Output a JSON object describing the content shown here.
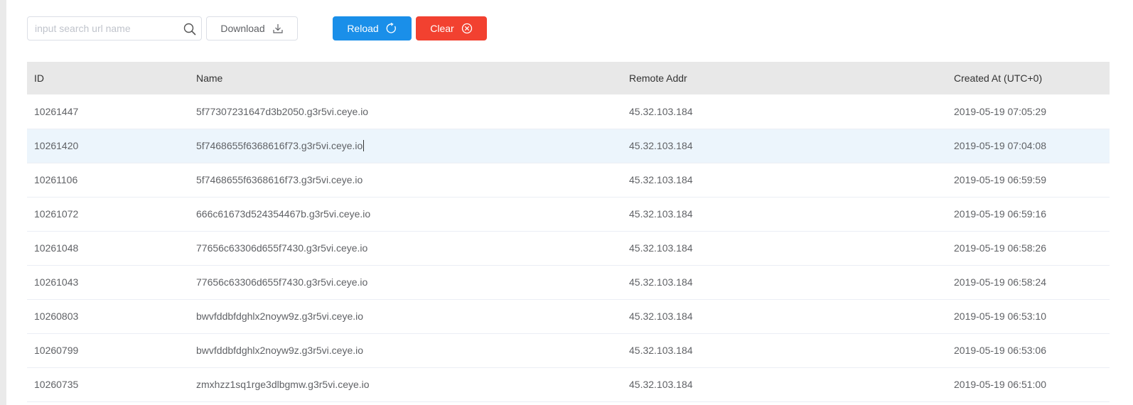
{
  "toolbar": {
    "search_placeholder": "input search url name",
    "search_value": "",
    "download_label": "Download",
    "reload_label": "Reload",
    "clear_label": "Clear"
  },
  "colors": {
    "reload_bg": "#1a8fe9",
    "clear_bg": "#f24130",
    "header_bg": "#e8e8e8",
    "highlight_row_bg": "#ecf5fc"
  },
  "icons": {
    "search": "search-icon",
    "download": "download-icon",
    "reload": "reload-icon",
    "clear": "clear-circle-icon"
  },
  "table": {
    "columns": [
      "ID",
      "Name",
      "Remote Addr",
      "Created At (UTC+0)"
    ],
    "rows": [
      {
        "id": "10261447",
        "name": "5f77307231647d3b2050.g3r5vi.ceye.io",
        "addr": "45.32.103.184",
        "created": "2019-05-19 07:05:29"
      },
      {
        "id": "10261420",
        "name": "5f7468655f6368616f73.g3r5vi.ceye.io",
        "addr": "45.32.103.184",
        "created": "2019-05-19 07:04:08"
      },
      {
        "id": "10261106",
        "name": "5f7468655f6368616f73.g3r5vi.ceye.io",
        "addr": "45.32.103.184",
        "created": "2019-05-19 06:59:59"
      },
      {
        "id": "10261072",
        "name": "666c61673d524354467b.g3r5vi.ceye.io",
        "addr": "45.32.103.184",
        "created": "2019-05-19 06:59:16"
      },
      {
        "id": "10261048",
        "name": "77656c63306d655f7430.g3r5vi.ceye.io",
        "addr": "45.32.103.184",
        "created": "2019-05-19 06:58:26"
      },
      {
        "id": "10261043",
        "name": "77656c63306d655f7430.g3r5vi.ceye.io",
        "addr": "45.32.103.184",
        "created": "2019-05-19 06:58:24"
      },
      {
        "id": "10260803",
        "name": "bwvfddbfdghlx2noyw9z.g3r5vi.ceye.io",
        "addr": "45.32.103.184",
        "created": "2019-05-19 06:53:10"
      },
      {
        "id": "10260799",
        "name": "bwvfddbfdghlx2noyw9z.g3r5vi.ceye.io",
        "addr": "45.32.103.184",
        "created": "2019-05-19 06:53:06"
      },
      {
        "id": "10260735",
        "name": "zmxhzz1sq1rge3dlbgmw.g3r5vi.ceye.io",
        "addr": "45.32.103.184",
        "created": "2019-05-19 06:51:00"
      }
    ]
  }
}
